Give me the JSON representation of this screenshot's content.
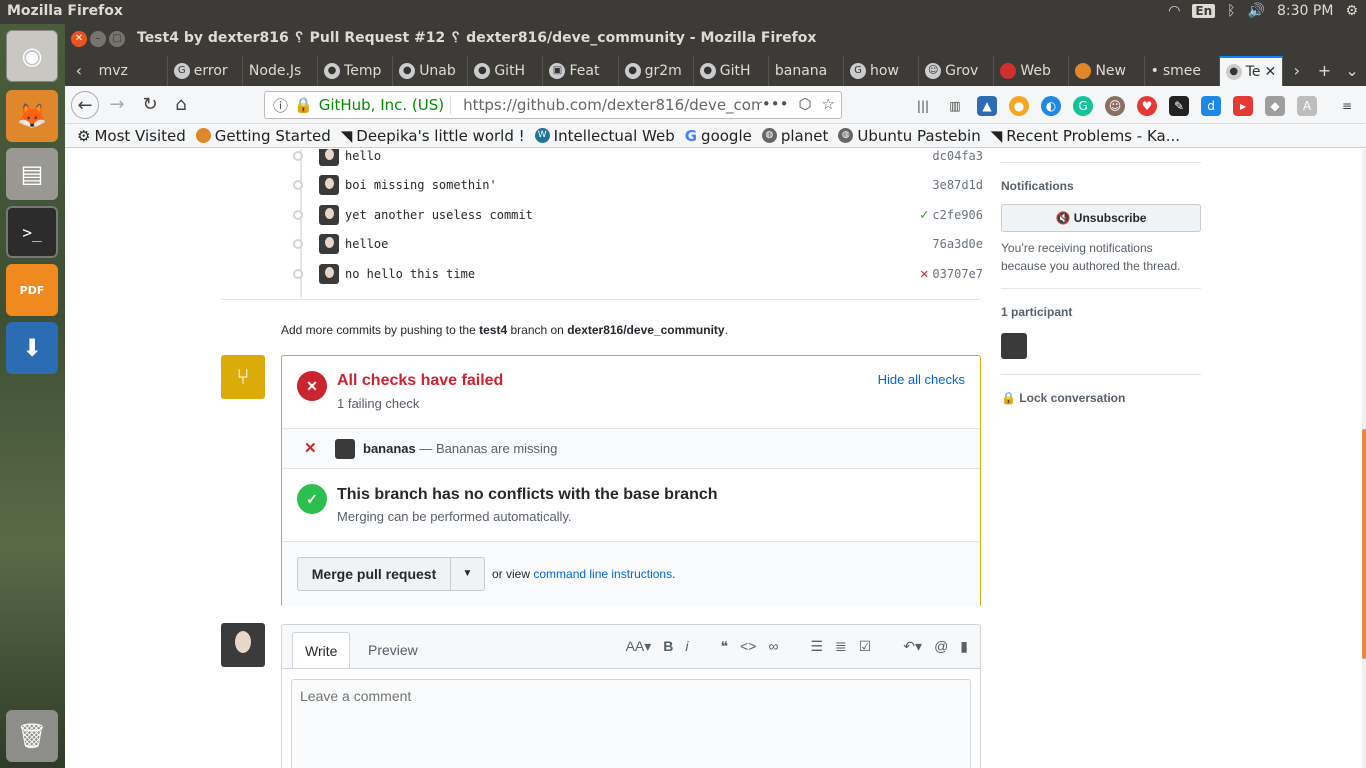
{
  "os": {
    "app_title": "Mozilla Firefox",
    "lang": "En",
    "time": "8:30 PM"
  },
  "window": {
    "title": "Test4 by dexter816 ␦ Pull Request #12 ␦ dexter816/deve_community - Mozilla Firefox"
  },
  "tabs": [
    {
      "label": "mvz"
    },
    {
      "label": "error"
    },
    {
      "label": "Node.Js"
    },
    {
      "label": "Temp"
    },
    {
      "label": "Unab"
    },
    {
      "label": "GitH"
    },
    {
      "label": "Feat"
    },
    {
      "label": "gr2m"
    },
    {
      "label": "GitH"
    },
    {
      "label": "banana"
    },
    {
      "label": "how"
    },
    {
      "label": "Grov"
    },
    {
      "label": "Web"
    },
    {
      "label": "New"
    },
    {
      "label": "smee"
    },
    {
      "label": "Te"
    }
  ],
  "urlbar": {
    "identity": "GitHub, Inc. (US)",
    "url": "https://github.com/dexter816/deve_com"
  },
  "bookmarks": [
    {
      "label": "Most Visited"
    },
    {
      "label": "Getting Started"
    },
    {
      "label": "Deepika's little world !"
    },
    {
      "label": "Intellectual Web"
    },
    {
      "label": "google"
    },
    {
      "label": "planet"
    },
    {
      "label": "Ubuntu Pastebin"
    },
    {
      "label": "Recent Problems - Ka..."
    }
  ],
  "commits": [
    {
      "message": "hello",
      "sha": "dc04fa3",
      "status": ""
    },
    {
      "message": "boi missing somethin'",
      "sha": "3e87d1d",
      "status": ""
    },
    {
      "message": "yet another useless commit",
      "sha": "c2fe906",
      "status": "success"
    },
    {
      "message": "helloe",
      "sha": "76a3d0e",
      "status": ""
    },
    {
      "message": "no hello this time",
      "sha": "03707e7",
      "status": "failure"
    }
  ],
  "add_commits": {
    "prefix": "Add more commits by pushing to the",
    "branch": "test4",
    "middle": "branch on",
    "repo": "dexter816/deve_community",
    "suffix": "."
  },
  "checks": {
    "title": "All checks have failed",
    "subtitle": "1 failing check",
    "hide_link": "Hide all checks",
    "check_name": "bananas",
    "check_desc": "— Bananas are missing"
  },
  "conflicts": {
    "title": "This branch has no conflicts with the base branch",
    "subtitle": "Merging can be performed automatically."
  },
  "merge": {
    "button": "Merge pull request",
    "or_view": "or view",
    "instructions_link": "command line instructions",
    "period": "."
  },
  "comment": {
    "tab_write": "Write",
    "tab_preview": "Preview",
    "placeholder": "Leave a comment"
  },
  "sidebar": {
    "notifications_heading": "Notifications",
    "unsubscribe": "Unsubscribe",
    "notification_note": "You’re receiving notifications because you authored the thread.",
    "participants_heading": "1 participant",
    "lock": "Lock conversation"
  }
}
